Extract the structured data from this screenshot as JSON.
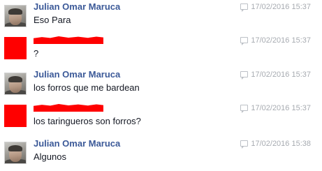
{
  "messages": [
    {
      "sender": "Julian Omar Maruca",
      "sender_redacted": false,
      "text": "Eso Para",
      "timestamp": "17/02/2016 15:37",
      "avatar": "profile-photo"
    },
    {
      "sender": "",
      "sender_redacted": true,
      "text": "?",
      "timestamp": "17/02/2016 15:37",
      "avatar": "redacted"
    },
    {
      "sender": "Julian Omar Maruca",
      "sender_redacted": false,
      "text": "los forros que me bardean",
      "timestamp": "17/02/2016 15:37",
      "avatar": "profile-photo"
    },
    {
      "sender": "",
      "sender_redacted": true,
      "text": "los taringueros son forros?",
      "timestamp": "17/02/2016 15:37",
      "avatar": "redacted"
    },
    {
      "sender": "Julian Omar Maruca",
      "sender_redacted": false,
      "text": "Algunos",
      "timestamp": "17/02/2016 15:38",
      "avatar": "profile-photo"
    }
  ],
  "icons": {
    "timestamp_icon": "chat-bubble-icon"
  },
  "colors": {
    "sender_name": "#3b5998",
    "message_text": "#141823",
    "timestamp": "#a7abb1",
    "redaction": "#ff0000"
  }
}
